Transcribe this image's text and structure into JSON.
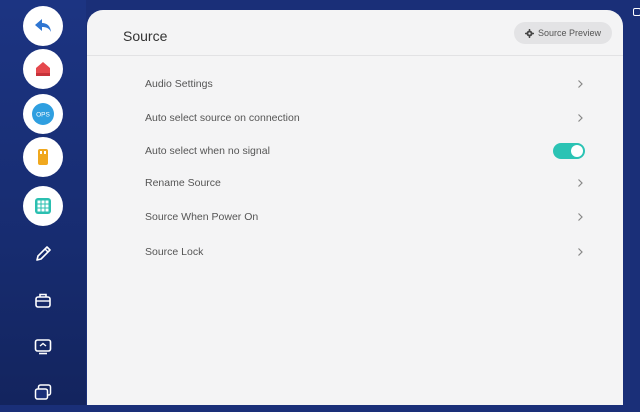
{
  "sidebar": {
    "items": [
      {
        "icon": "back-arrow-icon"
      },
      {
        "icon": "home-icon"
      },
      {
        "icon": "ops-icon",
        "label": "OPS"
      },
      {
        "icon": "usb-icon"
      },
      {
        "icon": "apps-grid-icon"
      },
      {
        "icon": "pen-icon"
      },
      {
        "icon": "toolbox-icon"
      },
      {
        "icon": "screen-cast-icon"
      },
      {
        "icon": "windows-icon"
      }
    ],
    "accent_back": "#2f76d2",
    "accent_home": "#e5484d",
    "accent_ops": "#2f9fe0",
    "accent_usb": "#f0a81e",
    "accent_apps": "#2bbfb0"
  },
  "header": {
    "title": "Source",
    "preview_label": "Source Preview",
    "preview_icon": "gear-icon"
  },
  "settings": [
    {
      "label": "Audio Settings",
      "control": "chevron"
    },
    {
      "label": "Auto select source on connection",
      "control": "chevron"
    },
    {
      "label": "Auto select when no signal",
      "control": "toggle",
      "value": true
    },
    {
      "label": "Rename Source",
      "control": "chevron"
    },
    {
      "label": "Source When Power On",
      "control": "chevron"
    },
    {
      "label": "Source Lock",
      "control": "chevron"
    }
  ],
  "toggle_color": "#2bc3b4"
}
